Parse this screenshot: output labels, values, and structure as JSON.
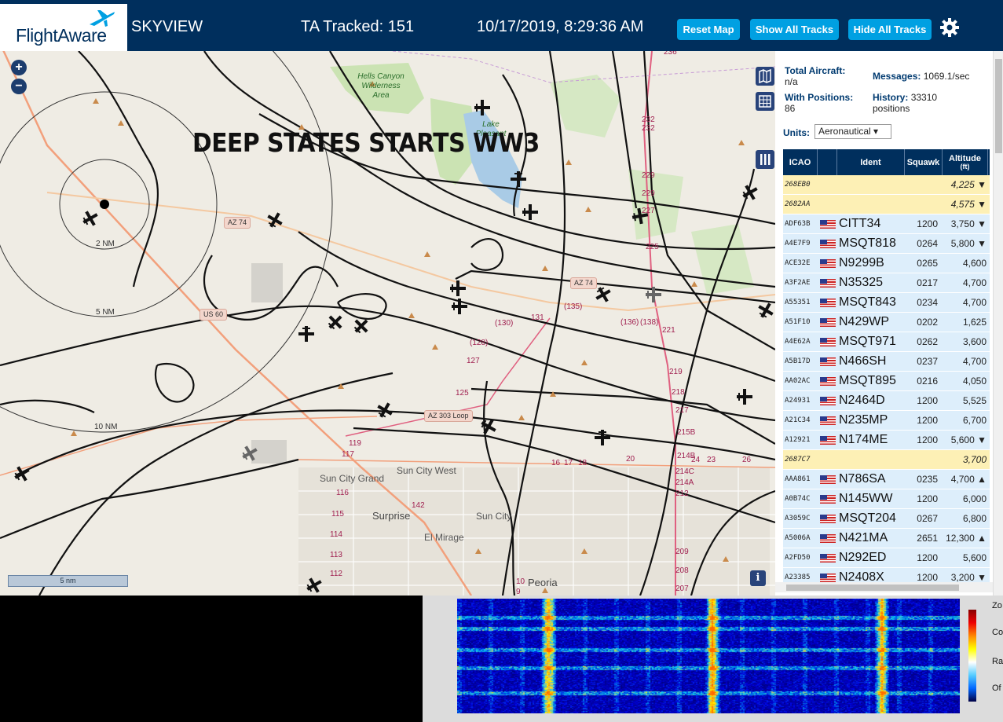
{
  "header": {
    "logo": "FlightAware",
    "title": "SKYVIEW",
    "tracked": "TA Tracked: 151",
    "datetime": "10/17/2019, 8:29:36 AM",
    "buttons": {
      "reset": "Reset Map",
      "show": "Show All Tracks",
      "hide": "Hide All Tracks"
    }
  },
  "map": {
    "overlay_text": "DEEP STATES STARTS WW3",
    "zoom_in": "+",
    "zoom_out": "−",
    "scale_label": "5 nm",
    "info": "i",
    "range_rings": [
      "2 NM",
      "5 NM",
      "10 NM"
    ],
    "places": [
      "Sun City Grand",
      "Sun City West",
      "Surprise",
      "Sun City",
      "El Mirage",
      "Peoria"
    ],
    "green_areas": [
      "Hells Canyon Wilderness Area",
      "Lake Pleasant"
    ],
    "highways": [
      "AZ 74",
      "AZ 74",
      "US 60",
      "AZ 303 Loop"
    ],
    "altitude_labels": [
      "(135)",
      "(130)",
      "(128)",
      "(136)",
      "(138)",
      "131",
      "127",
      "125",
      "119",
      "117",
      "116",
      "115",
      "114",
      "113",
      "112",
      "142",
      "229",
      "229",
      "227",
      "225",
      "221",
      "219",
      "218",
      "217",
      "215B",
      "214A",
      "214C",
      "214B",
      "212",
      "209",
      "208",
      "207",
      "232",
      "232",
      "236",
      "26",
      "23",
      "20",
      "18",
      "17",
      "16",
      "10",
      "9",
      "24"
    ]
  },
  "panel": {
    "total_aircraft_label": "Total Aircraft:",
    "total_aircraft_value": "n/a",
    "with_positions_label": "With Positions:",
    "with_positions_value": "86",
    "messages_label": "Messages:",
    "messages_value": "1069.1/sec",
    "history_label": "History:",
    "history_value": "33310",
    "history_unit": "positions",
    "units_label": "Units:",
    "units_value": "Aeronautical ▾",
    "columns": {
      "icao": "ICAO",
      "ident": "Ident",
      "squawk": "Squawk",
      "altitude": "Altitude",
      "altitude_unit": "(ft)"
    },
    "rows": [
      {
        "icao": "268EB0",
        "flag": false,
        "ident": "",
        "squawk": "",
        "alt": "4,225 ▼",
        "style": "yellow"
      },
      {
        "icao": "2682AA",
        "flag": false,
        "ident": "",
        "squawk": "",
        "alt": "4,575 ▼",
        "style": "yellow"
      },
      {
        "icao": "ADF63B",
        "flag": true,
        "ident": "CITT34",
        "squawk": "1200",
        "alt": "3,750 ▼",
        "style": "blue"
      },
      {
        "icao": "A4E7F9",
        "flag": true,
        "ident": "MSQT818",
        "squawk": "0264",
        "alt": "5,800 ▼",
        "style": "blue"
      },
      {
        "icao": "ACE32E",
        "flag": true,
        "ident": "N9299B",
        "squawk": "0265",
        "alt": "4,600",
        "style": "blue"
      },
      {
        "icao": "A3F2AE",
        "flag": true,
        "ident": "N35325",
        "squawk": "0217",
        "alt": "4,700",
        "style": "blue"
      },
      {
        "icao": "A55351",
        "flag": true,
        "ident": "MSQT843",
        "squawk": "0234",
        "alt": "4,700",
        "style": "blue"
      },
      {
        "icao": "A51F10",
        "flag": true,
        "ident": "N429WP",
        "squawk": "0202",
        "alt": "1,625",
        "style": "blue"
      },
      {
        "icao": "A4E62A",
        "flag": true,
        "ident": "MSQT971",
        "squawk": "0262",
        "alt": "3,600",
        "style": "blue"
      },
      {
        "icao": "A5B17D",
        "flag": true,
        "ident": "N466SH",
        "squawk": "0237",
        "alt": "4,700",
        "style": "blue"
      },
      {
        "icao": "AA02AC",
        "flag": true,
        "ident": "MSQT895",
        "squawk": "0216",
        "alt": "4,050",
        "style": "blue"
      },
      {
        "icao": "A24931",
        "flag": true,
        "ident": "N2464D",
        "squawk": "1200",
        "alt": "5,525",
        "style": "blue"
      },
      {
        "icao": "A21C34",
        "flag": true,
        "ident": "N235MP",
        "squawk": "1200",
        "alt": "6,700",
        "style": "blue"
      },
      {
        "icao": "A12921",
        "flag": true,
        "ident": "N174ME",
        "squawk": "1200",
        "alt": "5,600 ▼",
        "style": "blue"
      },
      {
        "icao": "2687C7",
        "flag": false,
        "ident": "",
        "squawk": "",
        "alt": "3,700",
        "style": "yellow"
      },
      {
        "icao": "AAA861",
        "flag": true,
        "ident": "N786SA",
        "squawk": "0235",
        "alt": "4,700 ▲",
        "style": "blue"
      },
      {
        "icao": "A0B74C",
        "flag": true,
        "ident": "N145WW",
        "squawk": "1200",
        "alt": "6,000",
        "style": "blue"
      },
      {
        "icao": "A3059C",
        "flag": true,
        "ident": "MSQT204",
        "squawk": "0267",
        "alt": "6,800",
        "style": "blue"
      },
      {
        "icao": "A5006A",
        "flag": true,
        "ident": "N421MA",
        "squawk": "2651",
        "alt": "12,300 ▲",
        "style": "blue"
      },
      {
        "icao": "A2FD50",
        "flag": true,
        "ident": "N292ED",
        "squawk": "1200",
        "alt": "5,600",
        "style": "blue"
      },
      {
        "icao": "A23385",
        "flag": true,
        "ident": "N2408X",
        "squawk": "1200",
        "alt": "3,200 ▼",
        "style": "blue"
      }
    ]
  },
  "waterfall": {
    "labels": [
      "Zo",
      "Co",
      "Ra",
      "Of"
    ]
  },
  "colors": {
    "header_bg": "#002f5d",
    "button_bg": "#00a0e2",
    "row_blue": "#ddeefb",
    "row_yellow": "#fdf0b5"
  }
}
